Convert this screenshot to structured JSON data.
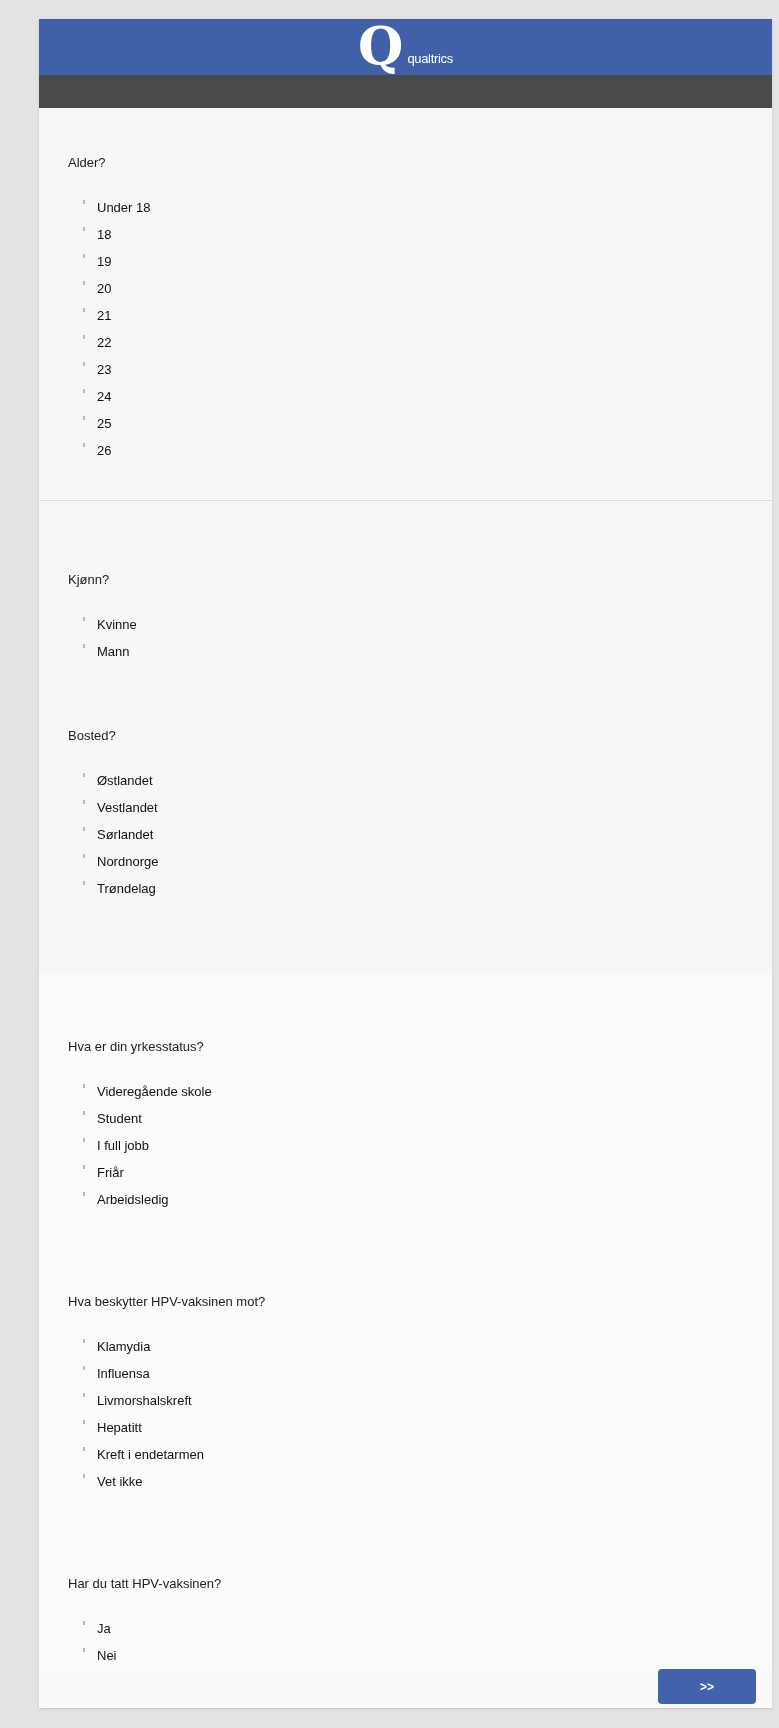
{
  "header": {
    "logo_mark": "Q",
    "logo_text": "qualtrics"
  },
  "blocks": [
    {
      "questions": [
        {
          "text": "Alder?",
          "options": [
            {
              "label": "Under 18",
              "selected": false
            },
            {
              "label": "18",
              "selected": false
            },
            {
              "label": "19",
              "selected": false
            },
            {
              "label": "20",
              "selected": false
            },
            {
              "label": "21",
              "selected": false
            },
            {
              "label": "22",
              "selected": false
            },
            {
              "label": "23",
              "selected": false
            },
            {
              "label": "24",
              "selected": false
            },
            {
              "label": "25",
              "selected": false
            },
            {
              "label": "26",
              "selected": false
            }
          ]
        }
      ]
    },
    {
      "questions": [
        {
          "text": "Kjønn?",
          "options": [
            {
              "label": "Kvinne",
              "selected": false
            },
            {
              "label": "Mann",
              "selected": false
            }
          ]
        },
        {
          "text": "Bosted?",
          "options": [
            {
              "label": "Østlandet",
              "selected": false
            },
            {
              "label": "Vestlandet",
              "selected": false
            },
            {
              "label": "Sørlandet",
              "selected": false
            },
            {
              "label": "Nordnorge",
              "selected": false
            },
            {
              "label": "Trøndelag",
              "selected": false
            }
          ]
        }
      ]
    },
    {
      "questions": [
        {
          "text": "Hva er din yrkesstatus?",
          "options": [
            {
              "label": "Videregående skole",
              "selected": false
            },
            {
              "label": "Student",
              "selected": false
            },
            {
              "label": "I full jobb",
              "selected": false
            },
            {
              "label": "Friår",
              "selected": false
            },
            {
              "label": "Arbeidsledig",
              "selected": false
            }
          ]
        },
        {
          "text": "Hva beskytter HPV-vaksinen mot?",
          "options": [
            {
              "label": "Klamydia",
              "selected": false
            },
            {
              "label": "Influensa",
              "selected": false
            },
            {
              "label": "Livmorshalskreft",
              "selected": false
            },
            {
              "label": "Hepatitt",
              "selected": false
            },
            {
              "label": "Kreft i endetarmen",
              "selected": false
            },
            {
              "label": "Vet ikke",
              "selected": false
            }
          ]
        },
        {
          "text": "Har du tatt HPV-vaksinen?",
          "options": [
            {
              "label": "Ja",
              "selected": false
            },
            {
              "label": "Nei",
              "selected": false
            }
          ]
        }
      ]
    }
  ],
  "next_button": ">>"
}
